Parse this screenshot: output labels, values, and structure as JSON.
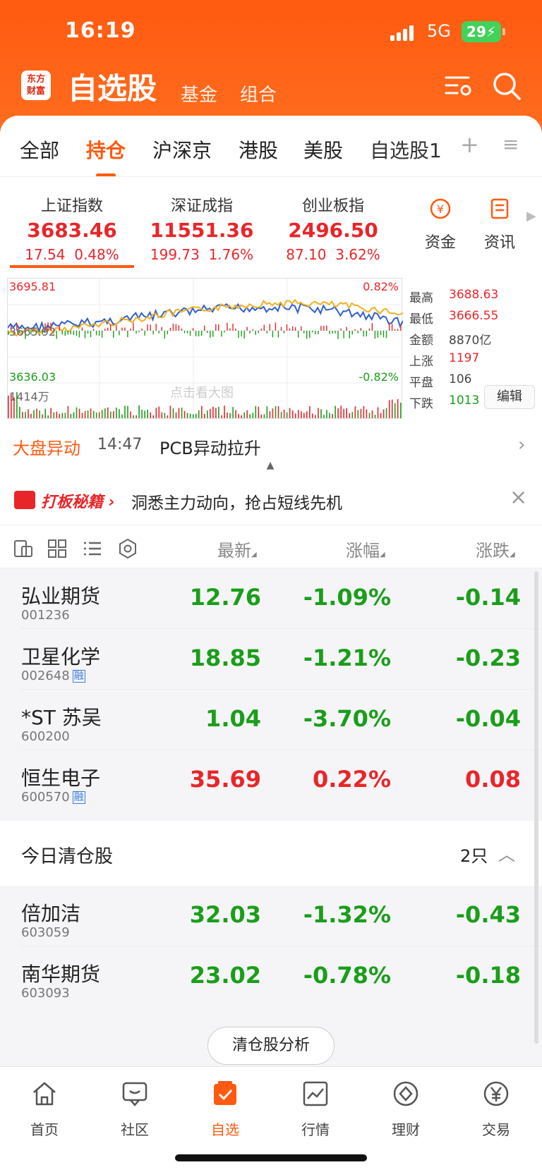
{
  "status": {
    "time": "16:19",
    "network": "5G",
    "battery": "29"
  },
  "app": {
    "logo_line1": "东方",
    "logo_line2": "财富",
    "title": "自选股",
    "sub1": "基金",
    "sub2": "组合"
  },
  "tabs": [
    {
      "label": "全部"
    },
    {
      "label": "持仓"
    },
    {
      "label": "沪深京"
    },
    {
      "label": "港股"
    },
    {
      "label": "美股"
    },
    {
      "label": "自选股1"
    }
  ],
  "indices": [
    {
      "name": "上证指数",
      "value": "3683.46",
      "change": "17.54",
      "pct": "0.48%"
    },
    {
      "name": "深证成指",
      "value": "11551.36",
      "change": "199.73",
      "pct": "1.76%"
    },
    {
      "name": "创业板指",
      "value": "2496.50",
      "change": "87.10",
      "pct": "3.62%"
    }
  ],
  "quick": {
    "funds": "资金",
    "news": "资讯"
  },
  "chart": {
    "high_label": "3695.81",
    "mid_label": "3665.92",
    "low_label": "3636.03",
    "up_pct": "0.82%",
    "down_pct": "-0.82%",
    "vol_label": "1414万",
    "watermark": "点击看大图"
  },
  "stats": [
    {
      "k": "最高",
      "v": "3688.63",
      "color": "#e8262a"
    },
    {
      "k": "最低",
      "v": "3666.55",
      "color": "#e8262a"
    },
    {
      "k": "金额",
      "v": "8870亿",
      "color": "#444444"
    },
    {
      "k": "上涨",
      "v": "1197",
      "color": "#e8262a"
    },
    {
      "k": "平盘",
      "v": "106",
      "color": "#444444"
    },
    {
      "k": "下跌",
      "v": "1013",
      "color": "#1a9e1a"
    }
  ],
  "edit_label": "编辑",
  "alert": {
    "tag": "大盘异动",
    "time": "14:47",
    "text": "PCB异动拉升"
  },
  "ad": {
    "brand": "打板秘籍",
    "text": "洞悉主力动向，抢占短线先机"
  },
  "columns": {
    "latest": "最新",
    "change_pct": "涨幅",
    "change": "涨跌"
  },
  "holdings": [
    {
      "name": "弘业期货",
      "code": "001236",
      "rong": "",
      "price": "12.76",
      "pct": "-1.09%",
      "chg": "-0.14",
      "up": false
    },
    {
      "name": "卫星化学",
      "code": "002648",
      "rong": "融",
      "price": "18.85",
      "pct": "-1.21%",
      "chg": "-0.23",
      "up": false
    },
    {
      "name": "*ST 苏吴",
      "code": "600200",
      "rong": "",
      "price": "1.04",
      "pct": "-3.70%",
      "chg": "-0.04",
      "up": false
    },
    {
      "name": "恒生电子",
      "code": "600570",
      "rong": "融",
      "price": "35.69",
      "pct": "0.22%",
      "chg": "0.08",
      "up": true
    }
  ],
  "cleared": {
    "title": "今日清仓股",
    "count": "2只",
    "items": [
      {
        "name": "倍加洁",
        "code": "603059",
        "rong": "",
        "price": "32.03",
        "pct": "-1.32%",
        "chg": "-0.43",
        "up": false
      },
      {
        "name": "南华期货",
        "code": "603093",
        "rong": "",
        "price": "23.02",
        "pct": "-0.78%",
        "chg": "-0.18",
        "up": false
      }
    ]
  },
  "analyze_label": "清仓股分析",
  "tabbar": [
    {
      "label": "首页"
    },
    {
      "label": "社区"
    },
    {
      "label": "自选"
    },
    {
      "label": "行情"
    },
    {
      "label": "理财"
    },
    {
      "label": "交易"
    }
  ]
}
